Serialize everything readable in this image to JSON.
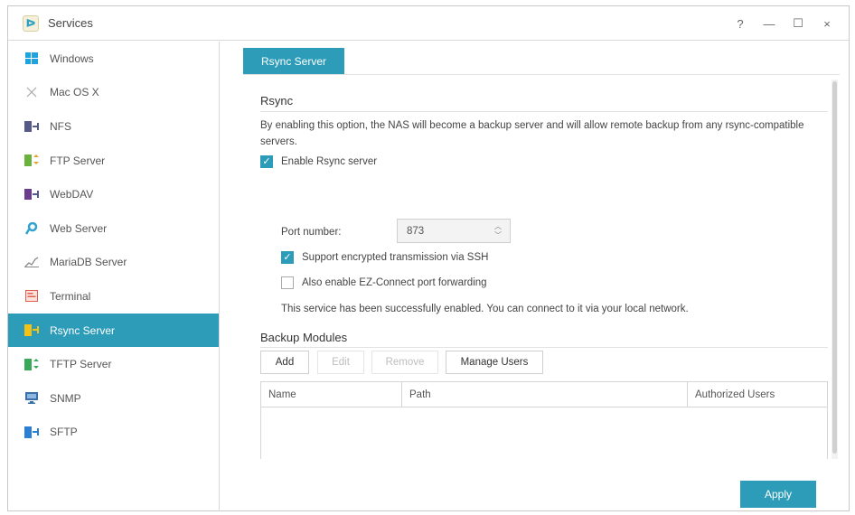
{
  "window": {
    "title": "Services",
    "controls": {
      "help": "?",
      "minimize": "—",
      "maximize": "☐",
      "close": "×"
    }
  },
  "sidebar": {
    "items": [
      {
        "label": "Windows",
        "icon": "windows-icon",
        "color": "#1fa3dd"
      },
      {
        "label": "Mac OS X",
        "icon": "mac-icon",
        "color": "#999999"
      },
      {
        "label": "NFS",
        "icon": "nfs-icon",
        "color": "#555a8a"
      },
      {
        "label": "FTP Server",
        "icon": "ftp-icon",
        "color": "#6bb23c"
      },
      {
        "label": "WebDAV",
        "icon": "webdav-icon",
        "color": "#6b3c8e"
      },
      {
        "label": "Web Server",
        "icon": "web-server-icon",
        "color": "#2fa3cf"
      },
      {
        "label": "MariaDB Server",
        "icon": "mariadb-icon",
        "color": "#888888"
      },
      {
        "label": "Terminal",
        "icon": "terminal-icon",
        "color": "#e0604f"
      },
      {
        "label": "Rsync Server",
        "icon": "rsync-icon",
        "color": "#f2c315",
        "active": true
      },
      {
        "label": "TFTP Server",
        "icon": "tftp-icon",
        "color": "#3aa859"
      },
      {
        "label": "SNMP",
        "icon": "snmp-icon",
        "color": "#3a6fa8"
      },
      {
        "label": "SFTP",
        "icon": "sftp-icon",
        "color": "#2b7fd4"
      }
    ]
  },
  "main": {
    "tab": "Rsync Server",
    "rsync": {
      "title": "Rsync",
      "description": "By enabling this option, the NAS will become a backup server and will allow remote backup from any rsync-compatible servers.",
      "enable_label": "Enable Rsync server",
      "enable_checked": true,
      "port_label": "Port number:",
      "port_value": "873",
      "ssh_label": "Support encrypted transmission via SSH",
      "ssh_checked": true,
      "ezconnect_label": "Also enable EZ-Connect port forwarding",
      "ezconnect_checked": false,
      "status": "This service has been successfully enabled. You can connect to it via your local network."
    },
    "backup_modules": {
      "title": "Backup Modules",
      "buttons": {
        "add": "Add",
        "edit": "Edit",
        "remove": "Remove",
        "manage_users": "Manage Users"
      },
      "columns": [
        "Name",
        "Path",
        "Authorized Users"
      ]
    },
    "apply_label": "Apply"
  },
  "colors": {
    "accent": "#2d9cb8"
  }
}
